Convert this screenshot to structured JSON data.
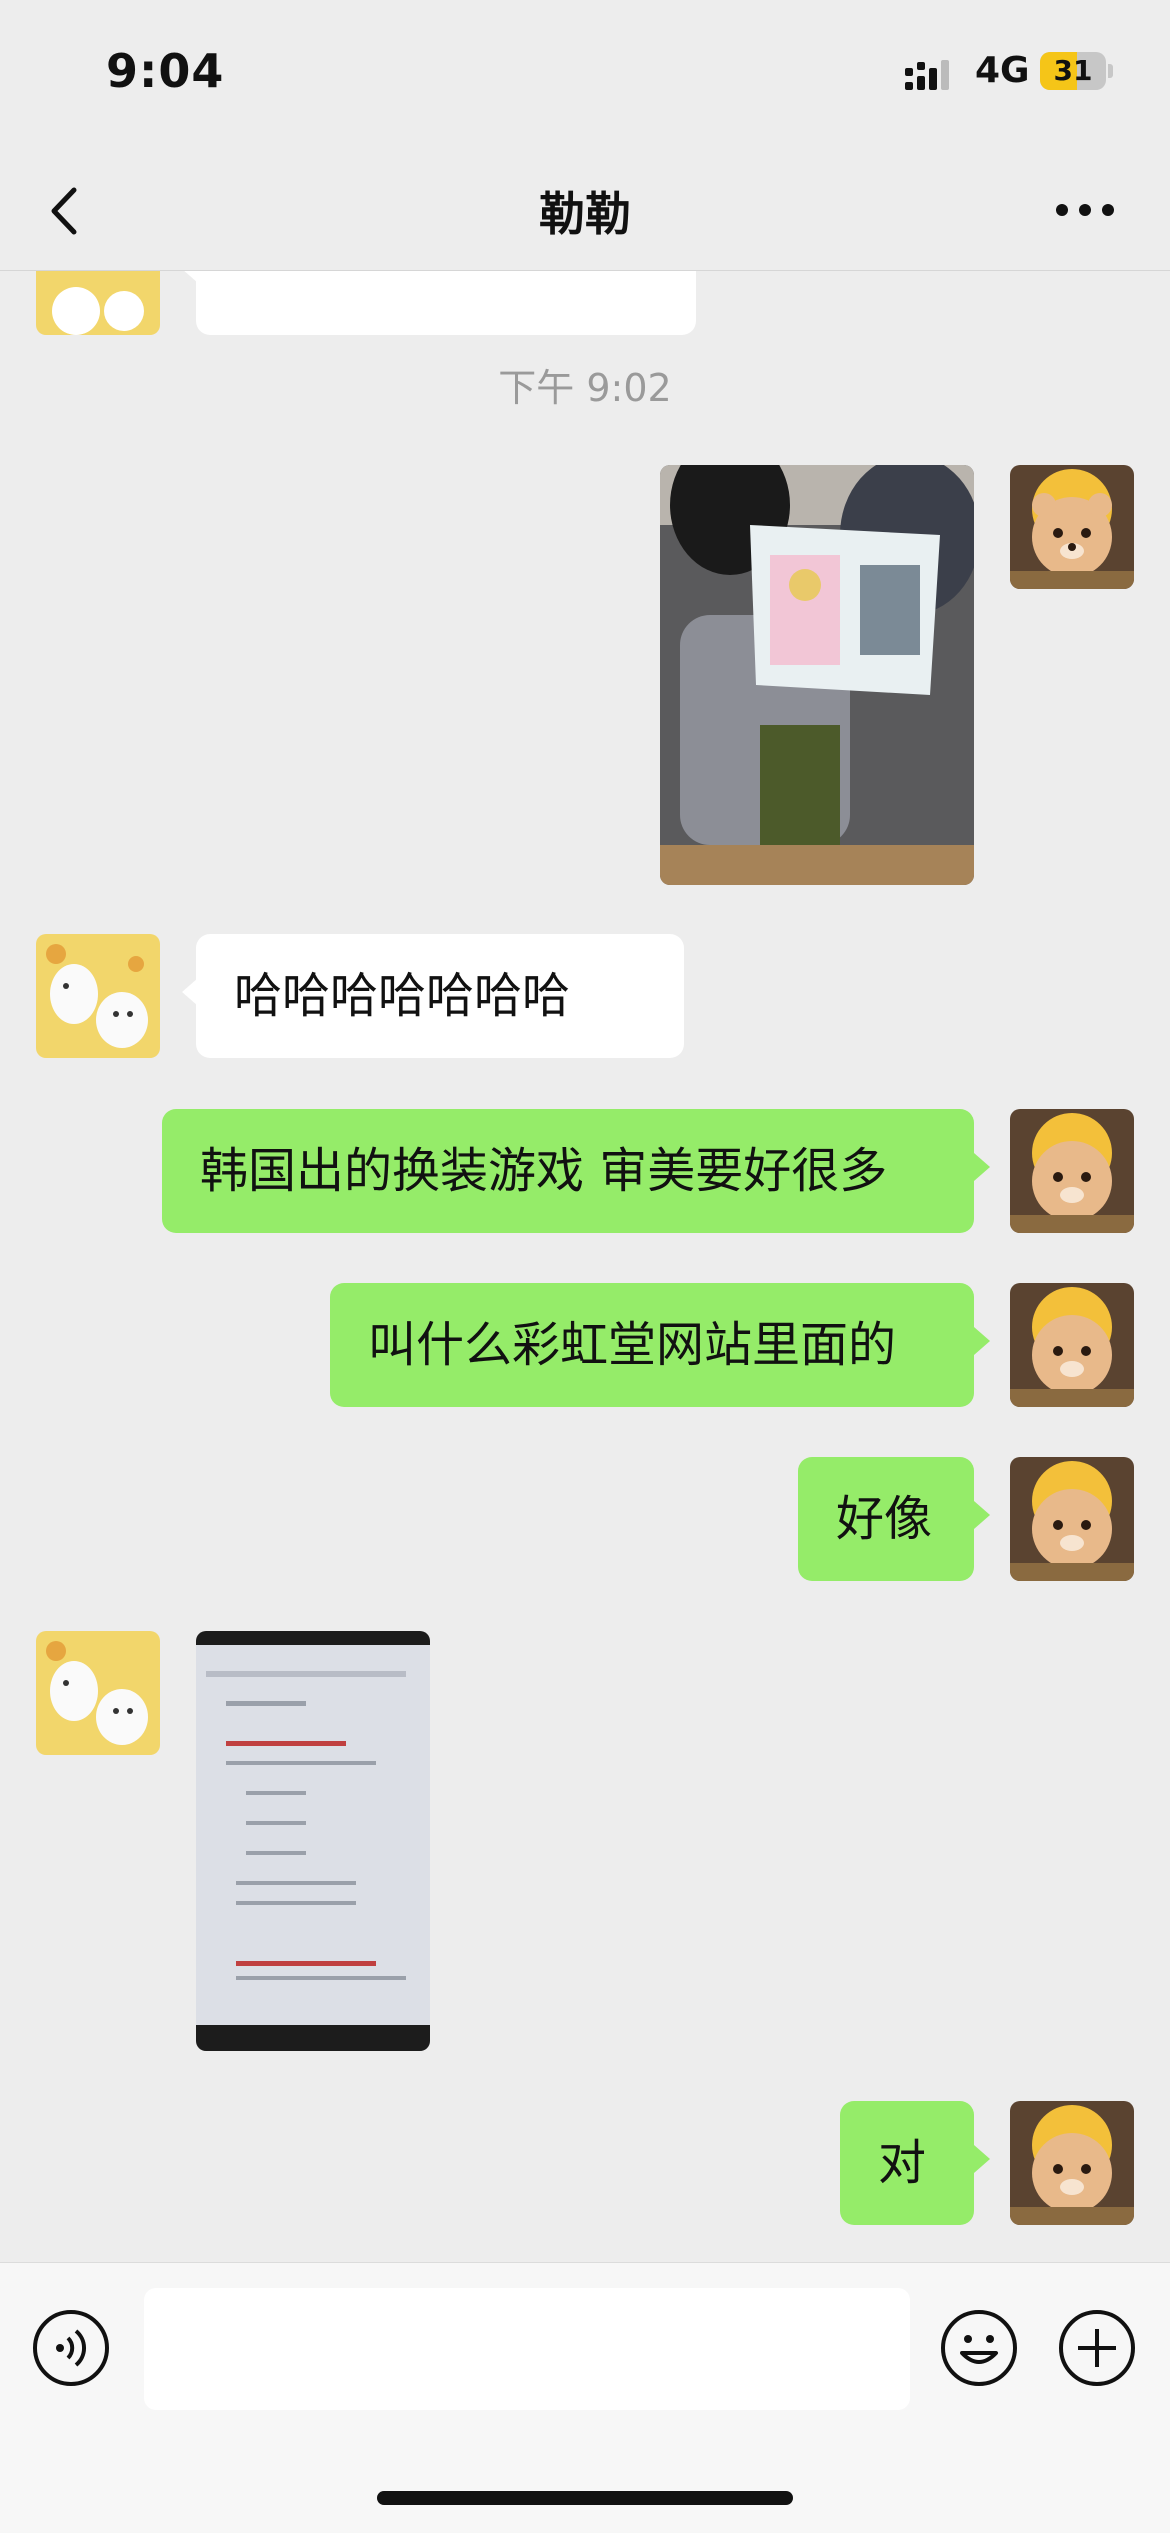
{
  "status_bar": {
    "time": "9:04",
    "network": "4G",
    "battery": "31",
    "battery_level": 0.31
  },
  "header": {
    "title": "勒勒"
  },
  "timestamp": "下午 9:02",
  "messages": [
    {
      "from": "other",
      "type": "image"
    },
    {
      "from": "me",
      "type": "image",
      "description_icon": "photo-of-laptop-dress-up-game"
    },
    {
      "from": "other",
      "type": "text",
      "text": "哈哈哈哈哈哈哈"
    },
    {
      "from": "me",
      "type": "text",
      "text": "韩国出的换装游戏 审美要好很多"
    },
    {
      "from": "me",
      "type": "text",
      "text": "叫什么彩虹堂网站里面的"
    },
    {
      "from": "me",
      "type": "text",
      "text": "好像"
    },
    {
      "from": "other",
      "type": "image",
      "description_icon": "photo-of-search-results-screen"
    },
    {
      "from": "me",
      "type": "text",
      "text": "对"
    }
  ],
  "input_bar": {
    "voice_icon": "voice-icon",
    "emoji_icon": "emoji-icon",
    "plus_icon": "plus-icon"
  },
  "colors": {
    "background": "#ededed",
    "outgoing_bubble": "#95ec69",
    "incoming_bubble": "#ffffff",
    "battery": "#f5c518"
  }
}
